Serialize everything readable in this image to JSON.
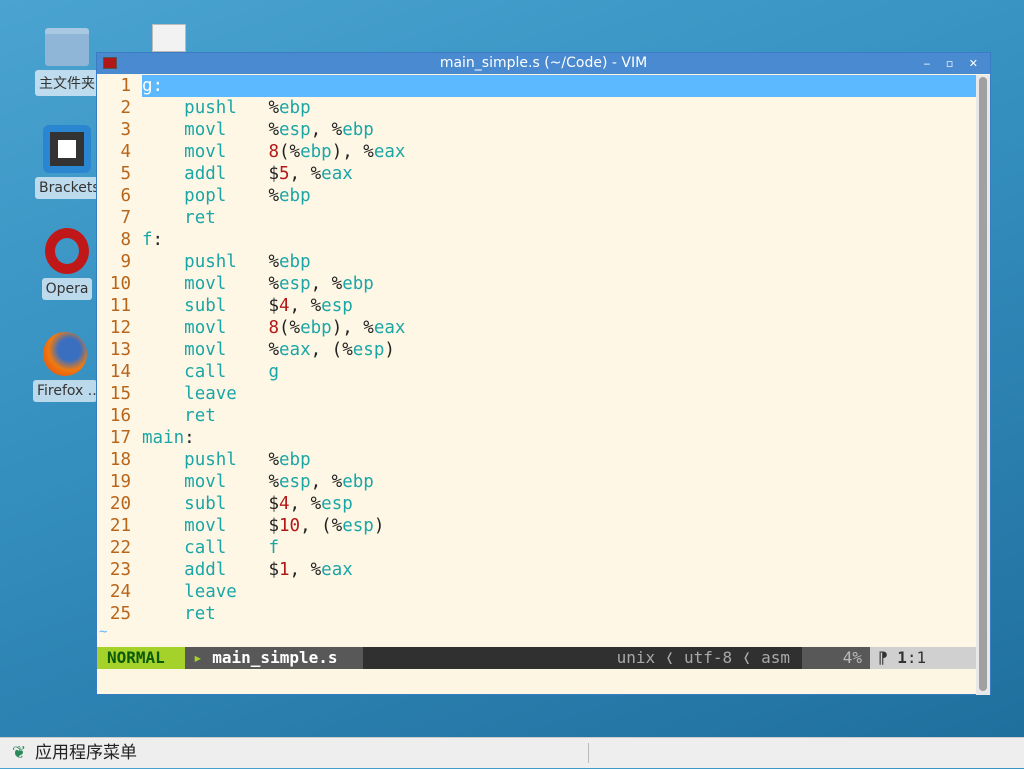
{
  "desktop": {
    "icons": [
      {
        "label": "主文件夹",
        "icon": "home-folder-icon"
      },
      {
        "label": "Brackets",
        "icon": "brackets-icon"
      },
      {
        "label": "Opera",
        "icon": "opera-icon"
      },
      {
        "label": "Firefox ..",
        "icon": "firefox-icon"
      }
    ]
  },
  "window": {
    "title": "main_simple.s (~/Code) - VIM",
    "controls": [
      "‒",
      "▫",
      "✕"
    ]
  },
  "editor": {
    "lines": [
      [
        [
          "label",
          "g:"
        ]
      ],
      [
        [
          "plain",
          "    "
        ],
        [
          "op",
          "pushl"
        ],
        [
          "plain",
          "   %"
        ],
        [
          "reg",
          "ebp"
        ]
      ],
      [
        [
          "plain",
          "    "
        ],
        [
          "op",
          "movl"
        ],
        [
          "plain",
          "    %"
        ],
        [
          "reg",
          "esp"
        ],
        [
          "plain",
          ", %"
        ],
        [
          "reg",
          "ebp"
        ]
      ],
      [
        [
          "plain",
          "    "
        ],
        [
          "op",
          "movl"
        ],
        [
          "plain",
          "    "
        ],
        [
          "num",
          "8"
        ],
        [
          "plain",
          "(%"
        ],
        [
          "reg",
          "ebp"
        ],
        [
          "plain",
          "), %"
        ],
        [
          "reg",
          "eax"
        ]
      ],
      [
        [
          "plain",
          "    "
        ],
        [
          "op",
          "addl"
        ],
        [
          "plain",
          "    $"
        ],
        [
          "num",
          "5"
        ],
        [
          "plain",
          ", %"
        ],
        [
          "reg",
          "eax"
        ]
      ],
      [
        [
          "plain",
          "    "
        ],
        [
          "op",
          "popl"
        ],
        [
          "plain",
          "    %"
        ],
        [
          "reg",
          "ebp"
        ]
      ],
      [
        [
          "plain",
          "    "
        ],
        [
          "op",
          "ret"
        ]
      ],
      [
        [
          "label",
          "f"
        ],
        [
          "plain",
          ":"
        ]
      ],
      [
        [
          "plain",
          "    "
        ],
        [
          "op",
          "pushl"
        ],
        [
          "plain",
          "   %"
        ],
        [
          "reg",
          "ebp"
        ]
      ],
      [
        [
          "plain",
          "    "
        ],
        [
          "op",
          "movl"
        ],
        [
          "plain",
          "    %"
        ],
        [
          "reg",
          "esp"
        ],
        [
          "plain",
          ", %"
        ],
        [
          "reg",
          "ebp"
        ]
      ],
      [
        [
          "plain",
          "    "
        ],
        [
          "op",
          "subl"
        ],
        [
          "plain",
          "    $"
        ],
        [
          "num",
          "4"
        ],
        [
          "plain",
          ", %"
        ],
        [
          "reg",
          "esp"
        ]
      ],
      [
        [
          "plain",
          "    "
        ],
        [
          "op",
          "movl"
        ],
        [
          "plain",
          "    "
        ],
        [
          "num",
          "8"
        ],
        [
          "plain",
          "(%"
        ],
        [
          "reg",
          "ebp"
        ],
        [
          "plain",
          "), %"
        ],
        [
          "reg",
          "eax"
        ]
      ],
      [
        [
          "plain",
          "    "
        ],
        [
          "op",
          "movl"
        ],
        [
          "plain",
          "    %"
        ],
        [
          "reg",
          "eax"
        ],
        [
          "plain",
          ", (%"
        ],
        [
          "reg",
          "esp"
        ],
        [
          "plain",
          ")"
        ]
      ],
      [
        [
          "plain",
          "    "
        ],
        [
          "op",
          "call"
        ],
        [
          "plain",
          "    "
        ],
        [
          "reg",
          "g"
        ]
      ],
      [
        [
          "plain",
          "    "
        ],
        [
          "op",
          "leave"
        ]
      ],
      [
        [
          "plain",
          "    "
        ],
        [
          "op",
          "ret"
        ]
      ],
      [
        [
          "label",
          "main"
        ],
        [
          "plain",
          ":"
        ]
      ],
      [
        [
          "plain",
          "    "
        ],
        [
          "op",
          "pushl"
        ],
        [
          "plain",
          "   %"
        ],
        [
          "reg",
          "ebp"
        ]
      ],
      [
        [
          "plain",
          "    "
        ],
        [
          "op",
          "movl"
        ],
        [
          "plain",
          "    %"
        ],
        [
          "reg",
          "esp"
        ],
        [
          "plain",
          ", %"
        ],
        [
          "reg",
          "ebp"
        ]
      ],
      [
        [
          "plain",
          "    "
        ],
        [
          "op",
          "subl"
        ],
        [
          "plain",
          "    $"
        ],
        [
          "num",
          "4"
        ],
        [
          "plain",
          ", %"
        ],
        [
          "reg",
          "esp"
        ]
      ],
      [
        [
          "plain",
          "    "
        ],
        [
          "op",
          "movl"
        ],
        [
          "plain",
          "    $"
        ],
        [
          "num",
          "10"
        ],
        [
          "plain",
          ", (%"
        ],
        [
          "reg",
          "esp"
        ],
        [
          "plain",
          ")"
        ]
      ],
      [
        [
          "plain",
          "    "
        ],
        [
          "op",
          "call"
        ],
        [
          "plain",
          "    "
        ],
        [
          "reg",
          "f"
        ]
      ],
      [
        [
          "plain",
          "    "
        ],
        [
          "op",
          "addl"
        ],
        [
          "plain",
          "    $"
        ],
        [
          "num",
          "1"
        ],
        [
          "plain",
          ", %"
        ],
        [
          "reg",
          "eax"
        ]
      ],
      [
        [
          "plain",
          "    "
        ],
        [
          "op",
          "leave"
        ]
      ],
      [
        [
          "plain",
          "    "
        ],
        [
          "op",
          "ret"
        ]
      ]
    ],
    "tilde": "~"
  },
  "statusline": {
    "mode": "NORMAL",
    "filename": "main_simple.s",
    "fileformat": "unix",
    "encoding": "utf-8",
    "filetype": "asm",
    "percent": "4%",
    "line": "1",
    "col": "1"
  },
  "taskbar": {
    "menu_label": "应用程序菜单"
  }
}
